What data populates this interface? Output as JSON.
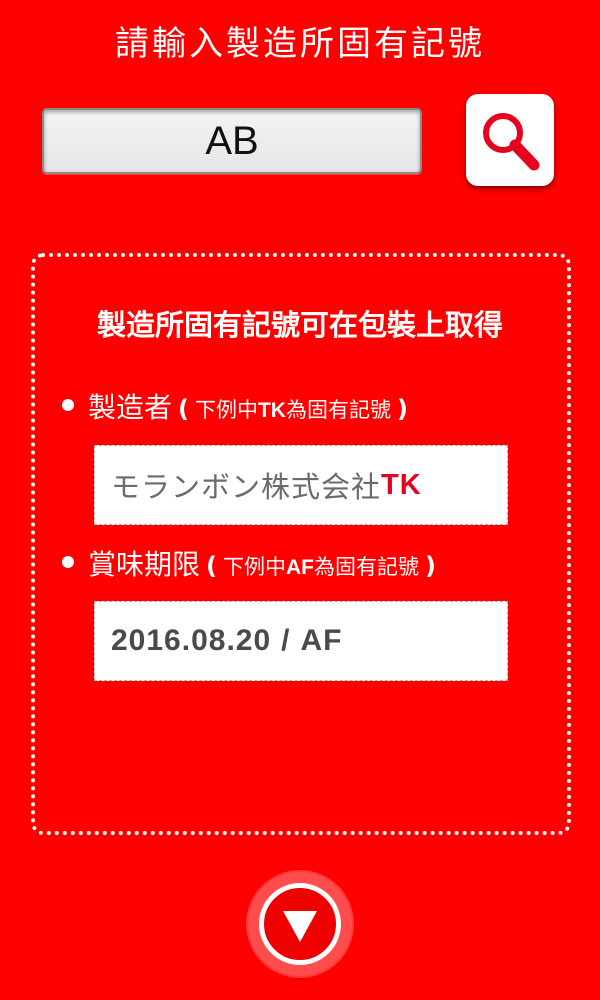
{
  "header": {
    "title": "請輸入製造所固有記號"
  },
  "search": {
    "value": "AB",
    "button_icon": "magnifier-icon"
  },
  "panel": {
    "heading": "製造所固有記號可在包裝上取得",
    "manufacturer": {
      "label": "製造者",
      "open_paren": "(",
      "hint_prefix": "下例中",
      "hint_code": "TK",
      "hint_suffix": "為固有記號",
      "close_paren": ")",
      "example_company": "モランボン株式会社",
      "example_code": "TK"
    },
    "expiry": {
      "label": "賞味期限",
      "open_paren": "(",
      "hint_prefix": "下例中",
      "hint_code": "AF",
      "hint_suffix": "為固有記號",
      "close_paren": ")",
      "example_date": "2016.08.20",
      "example_separator": "/",
      "example_code": "AF"
    }
  },
  "footer": {
    "next_icon": "down-triangle-icon"
  },
  "colors": {
    "background": "#ff0000",
    "code_red": "#e8001f",
    "text_white": "#ffffff"
  }
}
